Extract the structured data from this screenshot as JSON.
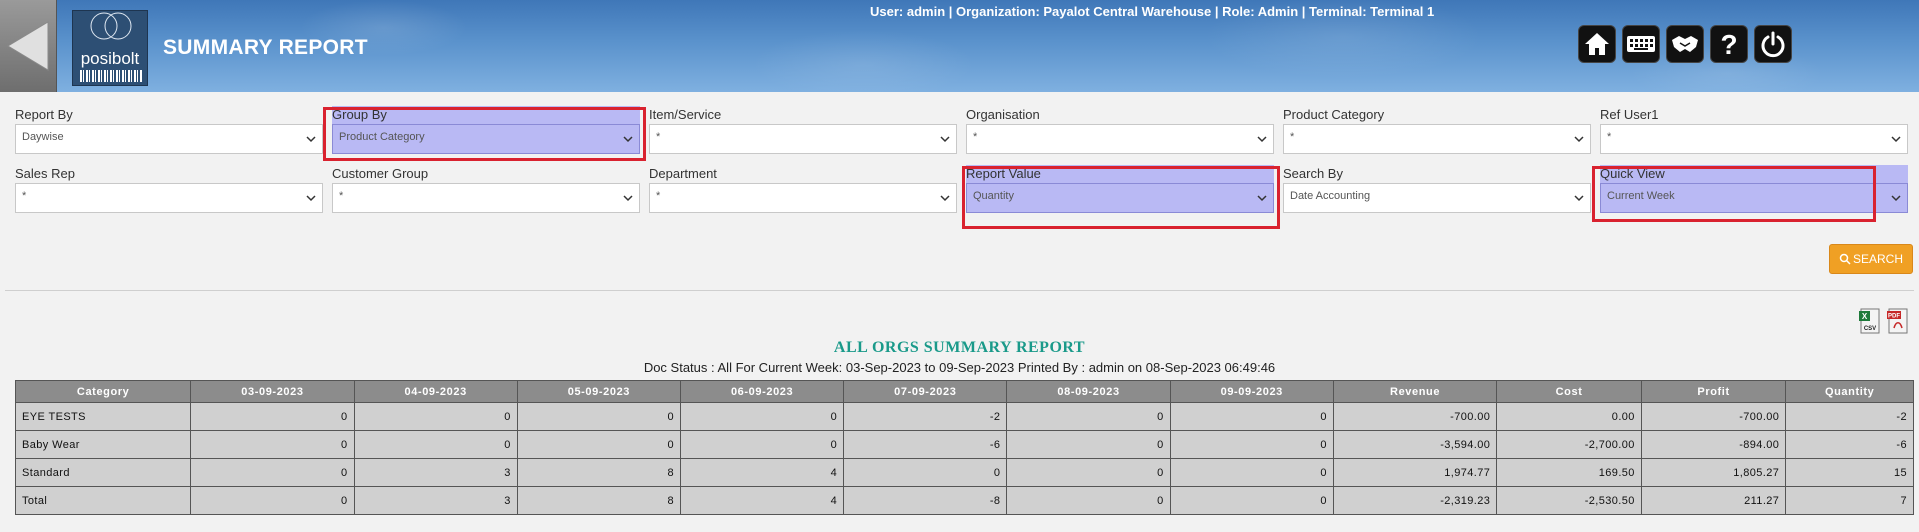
{
  "header": {
    "title": "SUMMARY REPORT",
    "logo_text": "posibolt",
    "user_info": "User: admin | Organization: Payalot Central Warehouse | Role: Admin | Terminal: Terminal 1",
    "icons": [
      "home-icon",
      "keyboard-icon",
      "handshake-icon",
      "help-icon",
      "power-icon"
    ]
  },
  "filters": {
    "report_by": {
      "label": "Report By",
      "value": "Daywise"
    },
    "group_by": {
      "label": "Group By",
      "value": "Product Category"
    },
    "item_service": {
      "label": "Item/Service",
      "value": "*"
    },
    "organisation": {
      "label": "Organisation",
      "value": "*"
    },
    "product_category": {
      "label": "Product Category",
      "value": "*"
    },
    "ref_user1": {
      "label": "Ref User1",
      "value": "*"
    },
    "sales_rep": {
      "label": "Sales Rep",
      "value": "*"
    },
    "customer_group": {
      "label": "Customer Group",
      "value": "*"
    },
    "department": {
      "label": "Department",
      "value": "*"
    },
    "report_value": {
      "label": "Report Value",
      "value": "Quantity"
    },
    "search_by": {
      "label": "Search By",
      "value": "Date Accounting"
    },
    "quick_view": {
      "label": "Quick View",
      "value": "Current Week"
    }
  },
  "search_button": "SEARCH",
  "export": [
    "csv-icon",
    "pdf-icon"
  ],
  "report": {
    "title": "ALL ORGS SUMMARY REPORT",
    "subtitle": "Doc Status : All For Current Week: 03-Sep-2023 to 09-Sep-2023 Printed By : admin on 08-Sep-2023 06:49:46",
    "columns": [
      "Category",
      "03-09-2023",
      "04-09-2023",
      "05-09-2023",
      "06-09-2023",
      "07-09-2023",
      "08-09-2023",
      "09-09-2023",
      "Revenue",
      "Cost",
      "Profit",
      "Quantity"
    ],
    "rows": [
      [
        "EYE TESTS",
        "0",
        "0",
        "0",
        "0",
        "-2",
        "0",
        "0",
        "-700.00",
        "0.00",
        "-700.00",
        "-2"
      ],
      [
        "Baby Wear",
        "0",
        "0",
        "0",
        "0",
        "-6",
        "0",
        "0",
        "-3,594.00",
        "-2,700.00",
        "-894.00",
        "-6"
      ],
      [
        "Standard",
        "0",
        "3",
        "8",
        "4",
        "0",
        "0",
        "0",
        "1,974.77",
        "169.50",
        "1,805.27",
        "15"
      ],
      [
        "Total",
        "0",
        "3",
        "8",
        "4",
        "-8",
        "0",
        "0",
        "-2,319.23",
        "-2,530.50",
        "211.27",
        "7"
      ]
    ]
  },
  "colors": {
    "header_blue": "#5a92cc",
    "highlight_fill": "#b9b9f4",
    "highlight_border": "#d9222f",
    "search_orange": "#f0a024",
    "report_title": "#1a9a8a",
    "table_header": "#8c8c8c",
    "table_cell": "#d0d0d0"
  }
}
